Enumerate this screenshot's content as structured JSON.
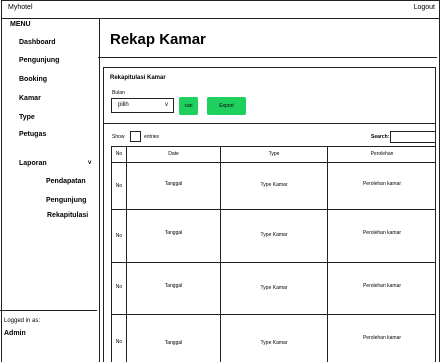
{
  "app": {
    "title": "Myhotel",
    "logout_label": "Logout"
  },
  "sidebar": {
    "menu_title": "MENU",
    "items": [
      {
        "label": "Dashboard"
      },
      {
        "label": "Pengunjung"
      },
      {
        "label": "Booking"
      },
      {
        "label": "Kamar"
      },
      {
        "label": "Type"
      },
      {
        "label": "Petugas"
      },
      {
        "label": "Laporan"
      }
    ],
    "laporan_caret": "v",
    "subitems": [
      {
        "label": "Pendapatan"
      },
      {
        "label": "Pengunjung"
      },
      {
        "label": "Rekapitulasi"
      }
    ],
    "logged_in_label": "Logged in as:",
    "logged_in_user": "Admin"
  },
  "main": {
    "page_title": "Rekap Kamar",
    "panel_title": "Rekapitulasi Kamar",
    "filter": {
      "label": "Bulan",
      "select_value": "pilih",
      "select_arrow": "v",
      "cari_label": "cari",
      "export_label": "Export"
    },
    "show_label": "Show",
    "entries_label": "entries",
    "search_label": "Search:",
    "table": {
      "headers": [
        "No",
        "Date",
        "Type",
        "Perolehan"
      ],
      "rows": [
        [
          "No",
          "Tanggal",
          "Type Kamar",
          "Perolehan kamar"
        ],
        [
          "No",
          "Tanggal",
          "Type Kamar",
          "Perolehan kamar"
        ],
        [
          "No",
          "Tanggal",
          "Type Kamar",
          "Perolehan kamar"
        ],
        [
          "No",
          "Tanggal",
          "Type Kamar",
          "Perolehan kamar"
        ]
      ]
    }
  }
}
